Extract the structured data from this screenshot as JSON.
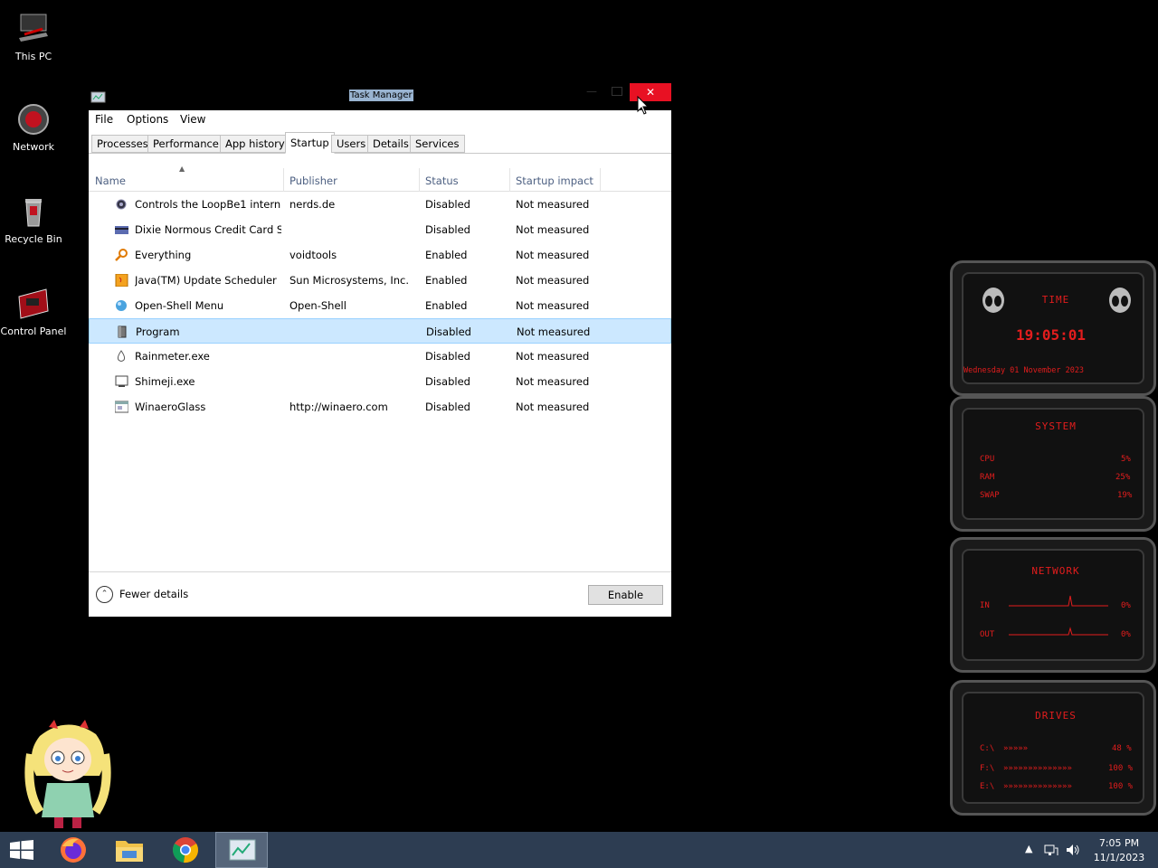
{
  "desktop": {
    "icons": [
      {
        "label": "This PC",
        "icon": "computer-icon"
      },
      {
        "label": "Network",
        "icon": "network-icon"
      },
      {
        "label": "Recycle Bin",
        "icon": "recycle-bin-icon"
      },
      {
        "label": "Control Panel",
        "icon": "control-panel-icon"
      }
    ]
  },
  "window": {
    "title": "Task Manager",
    "close_glyph": "✕",
    "minimize_glyph": "—"
  },
  "menu": [
    "File",
    "Options",
    "View"
  ],
  "tabs": [
    "Processes",
    "Performance",
    "App history",
    "Startup",
    "Users",
    "Details",
    "Services"
  ],
  "active_tab": "Startup",
  "columns": {
    "name": "Name",
    "publisher": "Publisher",
    "status": "Status",
    "impact": "Startup impact"
  },
  "rows": [
    {
      "name": "Controls the LoopBe1 intern...",
      "publisher": "nerds.de",
      "status": "Disabled",
      "impact": "Not measured",
      "icon": "loopbe-icon"
    },
    {
      "name": "Dixie Normous Credit Card S...",
      "publisher": "",
      "status": "Disabled",
      "impact": "Not measured",
      "icon": "credit-card-icon"
    },
    {
      "name": "Everything",
      "publisher": "voidtools",
      "status": "Enabled",
      "impact": "Not measured",
      "icon": "search-magnifier-icon"
    },
    {
      "name": "Java(TM) Update Scheduler",
      "publisher": "Sun Microsystems, Inc.",
      "status": "Enabled",
      "impact": "Not measured",
      "icon": "java-icon"
    },
    {
      "name": "Open-Shell Menu",
      "publisher": "Open-Shell",
      "status": "Enabled",
      "impact": "Not measured",
      "icon": "shell-orb-icon"
    },
    {
      "name": "Program",
      "publisher": "",
      "status": "Disabled",
      "impact": "Not measured",
      "icon": "program-icon",
      "selected": true
    },
    {
      "name": "Rainmeter.exe",
      "publisher": "",
      "status": "Disabled",
      "impact": "Not measured",
      "icon": "rainmeter-drop-icon"
    },
    {
      "name": "Shimeji.exe",
      "publisher": "",
      "status": "Disabled",
      "impact": "Not measured",
      "icon": "shimeji-icon"
    },
    {
      "name": "WinaeroGlass",
      "publisher": "http://winaero.com",
      "status": "Disabled",
      "impact": "Not measured",
      "icon": "winaero-glass-icon"
    }
  ],
  "footer": {
    "fewer_details": "Fewer details",
    "enable": "Enable"
  },
  "widget": {
    "time_title": "TIME",
    "time_value": "19:05:01",
    "date_value": "Wednesday 01 November 2023",
    "system_title": "SYSTEM",
    "cpu_label": "CPU",
    "cpu_value": "5%",
    "ram_label": "RAM",
    "ram_value": "25%",
    "swap_label": "SWAP",
    "swap_value": "19%",
    "network_title": "NETWORK",
    "in_label": "IN",
    "in_value": "0%",
    "out_label": "OUT",
    "out_value": "0%",
    "drives_title": "DRIVES",
    "drive1_label": "C:\\",
    "drive1_value": "48 %",
    "drive2_label": "F:\\",
    "drive2_value": "100 %",
    "drive3_label": "E:\\",
    "drive3_value": "100 %",
    "accent": "#e21d1d"
  },
  "taskbar": {
    "items": [
      "start-icon",
      "firefox-icon",
      "file-explorer-icon",
      "chrome-icon",
      "task-manager-icon"
    ],
    "clock_time": "7:05 PM",
    "clock_date": "11/1/2023",
    "bg_color": "#2d3d52"
  }
}
